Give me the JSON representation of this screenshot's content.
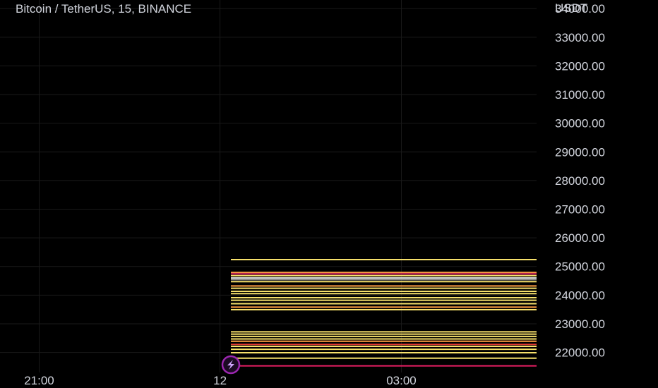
{
  "chart_data": {
    "type": "line",
    "title": "Bitcoin / TetherUS, 15, BINANCE",
    "y_unit": "USDT",
    "ylim": [
      21300,
      34300
    ],
    "y_ticks": [
      "22000.00",
      "23000.00",
      "24000.00",
      "25000.00",
      "26000.00",
      "27000.00",
      "28000.00",
      "29000.00",
      "30000.00",
      "31000.00",
      "32000.00",
      "33000.00",
      "34000.00"
    ],
    "x_ticks": [
      {
        "label": "21:00",
        "pos": 0.073
      },
      {
        "label": "12",
        "pos": 0.41
      },
      {
        "label": "03:00",
        "pos": 0.748
      }
    ],
    "grid": true,
    "levels": [
      {
        "value": 25240,
        "color": "#f6e06b"
      },
      {
        "value": 24790,
        "color": "#ff9f43"
      },
      {
        "value": 24740,
        "color": "#c2185b"
      },
      {
        "value": 24680,
        "color": "#f6e06b"
      },
      {
        "value": 24600,
        "color": "#e0e0e0"
      },
      {
        "value": 24540,
        "color": "#9e9e9e"
      },
      {
        "value": 24470,
        "color": "#f6e06b"
      },
      {
        "value": 24320,
        "color": "#ff9f43"
      },
      {
        "value": 24240,
        "color": "#f6e06b"
      },
      {
        "value": 24130,
        "color": "#f6e06b"
      },
      {
        "value": 24050,
        "color": "#f6e06b"
      },
      {
        "value": 23910,
        "color": "#f6e06b"
      },
      {
        "value": 23820,
        "color": "#f6e06b"
      },
      {
        "value": 23700,
        "color": "#f6e06b"
      },
      {
        "value": 23580,
        "color": "#ff9f43"
      },
      {
        "value": 23490,
        "color": "#f6e06b"
      },
      {
        "value": 22720,
        "color": "#f6e06b"
      },
      {
        "value": 22640,
        "color": "#f6e06b"
      },
      {
        "value": 22560,
        "color": "#f6e06b"
      },
      {
        "value": 22470,
        "color": "#f6e06b"
      },
      {
        "value": 22390,
        "color": "#ff9f43"
      },
      {
        "value": 22280,
        "color": "#e53935"
      },
      {
        "value": 22210,
        "color": "#f6e06b"
      },
      {
        "value": 22110,
        "color": "#f6e06b"
      },
      {
        "value": 21990,
        "color": "#f6e06b"
      },
      {
        "value": 21800,
        "color": "#f6e06b"
      },
      {
        "value": 21530,
        "color": "#e91e63"
      }
    ],
    "colors": {
      "background": "#000000",
      "text": "#d1d4dc",
      "grid": "#1a1a1a",
      "marker": "#9c27b0"
    },
    "marker_icon": "lightning-icon"
  }
}
